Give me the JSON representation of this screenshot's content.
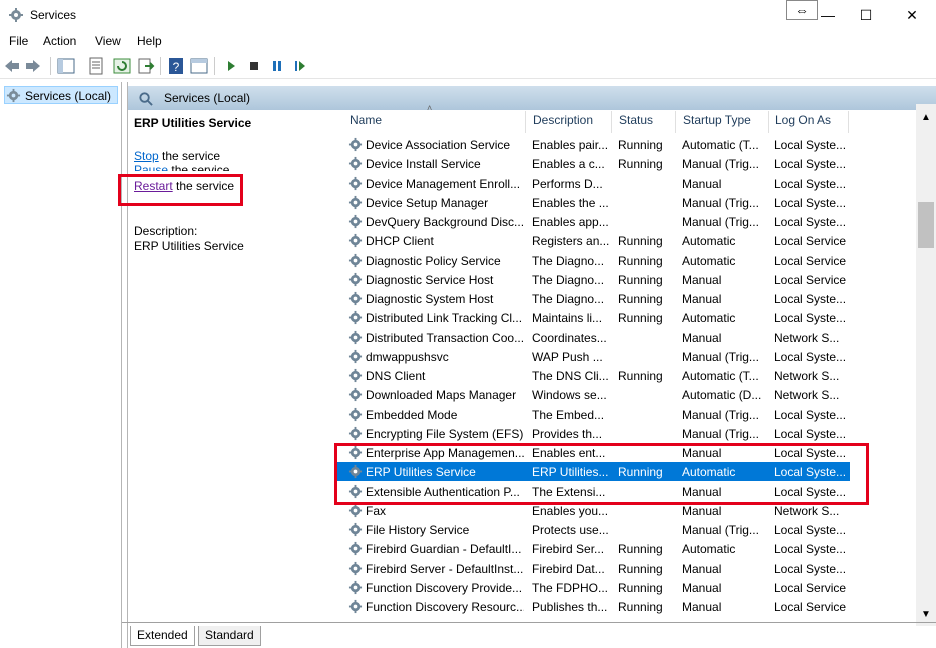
{
  "window": {
    "title": "Services",
    "resize_glyph": "⇔",
    "minimize": "—",
    "maximize": "☐",
    "close": "✕"
  },
  "menu": [
    "File",
    "Action",
    "View",
    "Help"
  ],
  "toolbar_icons": [
    "back-icon",
    "forward-icon",
    "show-hide-console-tree-icon",
    "properties-icon",
    "refresh-icon",
    "export-list-icon",
    "help-icon",
    "action-pane-icon",
    "start-service-icon",
    "stop-service-icon",
    "pause-service-icon",
    "resume-service-icon"
  ],
  "tree": {
    "label": "Services (Local)"
  },
  "panel": {
    "header": "Services (Local)"
  },
  "extended": {
    "service_name": "ERP Utilities Service",
    "stop_link": "Stop",
    "stop_suffix": " the service",
    "pause_link": "Pause",
    "pause_suffix": " the service",
    "restart_link": "Restart",
    "restart_suffix": " the service",
    "description_label": "Description:",
    "description_text": "ERP Utilities Service"
  },
  "columns": [
    "Name",
    "Description",
    "Status",
    "Startup Type",
    "Log On As"
  ],
  "rows": [
    {
      "name": "Device Association Service",
      "desc": "Enables pair...",
      "status": "Running",
      "startup": "Automatic (T...",
      "logon": "Local Syste..."
    },
    {
      "name": "Device Install Service",
      "desc": "Enables a c...",
      "status": "Running",
      "startup": "Manual (Trig...",
      "logon": "Local Syste..."
    },
    {
      "name": "Device Management Enroll...",
      "desc": "Performs D...",
      "status": "",
      "startup": "Manual",
      "logon": "Local Syste..."
    },
    {
      "name": "Device Setup Manager",
      "desc": "Enables the ...",
      "status": "",
      "startup": "Manual (Trig...",
      "logon": "Local Syste..."
    },
    {
      "name": "DevQuery Background Disc...",
      "desc": "Enables app...",
      "status": "",
      "startup": "Manual (Trig...",
      "logon": "Local Syste..."
    },
    {
      "name": "DHCP Client",
      "desc": "Registers an...",
      "status": "Running",
      "startup": "Automatic",
      "logon": "Local Service"
    },
    {
      "name": "Diagnostic Policy Service",
      "desc": "The Diagno...",
      "status": "Running",
      "startup": "Automatic",
      "logon": "Local Service"
    },
    {
      "name": "Diagnostic Service Host",
      "desc": "The Diagno...",
      "status": "Running",
      "startup": "Manual",
      "logon": "Local Service"
    },
    {
      "name": "Diagnostic System Host",
      "desc": "The Diagno...",
      "status": "Running",
      "startup": "Manual",
      "logon": "Local Syste..."
    },
    {
      "name": "Distributed Link Tracking Cl...",
      "desc": "Maintains li...",
      "status": "Running",
      "startup": "Automatic",
      "logon": "Local Syste..."
    },
    {
      "name": "Distributed Transaction Coo...",
      "desc": "Coordinates...",
      "status": "",
      "startup": "Manual",
      "logon": "Network S..."
    },
    {
      "name": "dmwappushsvc",
      "desc": "WAP Push ...",
      "status": "",
      "startup": "Manual (Trig...",
      "logon": "Local Syste..."
    },
    {
      "name": "DNS Client",
      "desc": "The DNS Cli...",
      "status": "Running",
      "startup": "Automatic (T...",
      "logon": "Network S..."
    },
    {
      "name": "Downloaded Maps Manager",
      "desc": "Windows se...",
      "status": "",
      "startup": "Automatic (D...",
      "logon": "Network S..."
    },
    {
      "name": "Embedded Mode",
      "desc": "The Embed...",
      "status": "",
      "startup": "Manual (Trig...",
      "logon": "Local Syste..."
    },
    {
      "name": "Encrypting File System (EFS)",
      "desc": "Provides th...",
      "status": "",
      "startup": "Manual (Trig...",
      "logon": "Local Syste..."
    },
    {
      "name": "Enterprise App Managemen...",
      "desc": "Enables ent...",
      "status": "",
      "startup": "Manual",
      "logon": "Local Syste..."
    },
    {
      "name": "ERP Utilities Service",
      "desc": "ERP Utilities...",
      "status": "Running",
      "startup": "Automatic",
      "logon": "Local Syste...",
      "selected": true
    },
    {
      "name": "Extensible Authentication P...",
      "desc": "The Extensi...",
      "status": "",
      "startup": "Manual",
      "logon": "Local Syste..."
    },
    {
      "name": "Fax",
      "desc": "Enables you...",
      "status": "",
      "startup": "Manual",
      "logon": "Network S..."
    },
    {
      "name": "File History Service",
      "desc": "Protects use...",
      "status": "",
      "startup": "Manual (Trig...",
      "logon": "Local Syste..."
    },
    {
      "name": "Firebird Guardian - DefaultI...",
      "desc": "Firebird Ser...",
      "status": "Running",
      "startup": "Automatic",
      "logon": "Local Syste..."
    },
    {
      "name": "Firebird Server - DefaultInst...",
      "desc": "Firebird Dat...",
      "status": "Running",
      "startup": "Manual",
      "logon": "Local Syste..."
    },
    {
      "name": "Function Discovery Provide...",
      "desc": "The FDPHO...",
      "status": "Running",
      "startup": "Manual",
      "logon": "Local Service"
    },
    {
      "name": "Function Discovery Resourc...",
      "desc": "Publishes th...",
      "status": "Running",
      "startup": "Manual",
      "logon": "Local Service"
    }
  ],
  "tabs": [
    "Extended",
    "Standard"
  ]
}
